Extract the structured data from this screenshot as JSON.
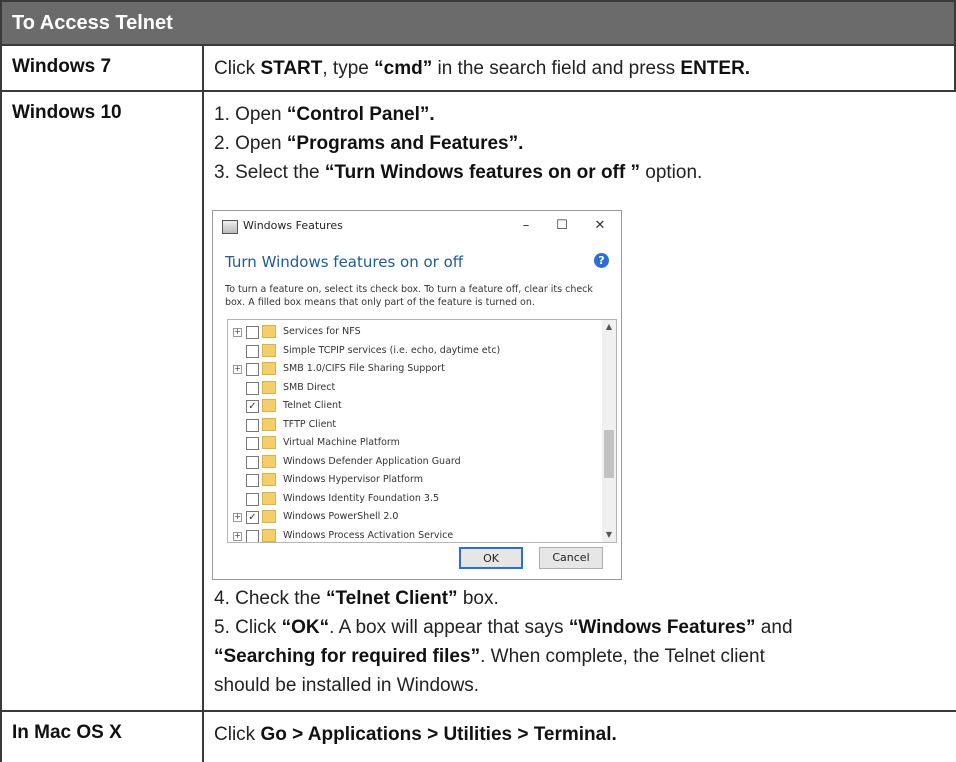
{
  "header": "To Access Telnet",
  "rows": {
    "win7": {
      "label": "Windows 7",
      "t1": "Click ",
      "b1": "START",
      "t2": ", type ",
      "b2": "“cmd”",
      "t3": " in the search field and press ",
      "b3": "ENTER."
    },
    "win10": {
      "label": "Windows 10",
      "step1_pre": "1. Open ",
      "step1_b": "“Control Panel”.",
      "step2_pre": "2. Open ",
      "step2_b": "“Programs and Features”.",
      "step3_pre": "3. Select the ",
      "step3_b": "“Turn Windows features on or off ”",
      "step3_post": " option.",
      "step4_pre": "4. Check the ",
      "step4_b": "“Telnet Client”",
      "step4_post": " box.",
      "step5_pre": "5. Click ",
      "step5_b1": "“OK“",
      "step5_mid": ". A box will appear that says ",
      "step5_b2": "“Windows Features”",
      "step5_and": " and",
      "step5_b3": "“Searching for required files”",
      "step5_post1": ". When complete, the Telnet client",
      "step5_post2": "should be installed in Windows."
    },
    "mac": {
      "label": "In Mac OS X",
      "pre": "Click ",
      "b": "Go > Applications > Utilities > Terminal."
    }
  },
  "dialog": {
    "title": "Windows Features",
    "minimize": "–",
    "maximize": "☐",
    "close": "✕",
    "heading": "Turn Windows features on or off",
    "help": "?",
    "description": "To turn a feature on, select its check box. To turn a feature off, clear its check box. A filled box means that only part of the feature is turned on.",
    "items": [
      {
        "label": "Services for NFS",
        "expand": true,
        "checked": false
      },
      {
        "label": "Simple TCPIP services (i.e. echo, daytime etc)",
        "expand": false,
        "checked": false
      },
      {
        "label": "SMB 1.0/CIFS File Sharing Support",
        "expand": true,
        "checked": false
      },
      {
        "label": "SMB Direct",
        "expand": false,
        "checked": false
      },
      {
        "label": "Telnet Client",
        "expand": false,
        "checked": true
      },
      {
        "label": "TFTP Client",
        "expand": false,
        "checked": false
      },
      {
        "label": "Virtual Machine Platform",
        "expand": false,
        "checked": false
      },
      {
        "label": "Windows Defender Application Guard",
        "expand": false,
        "checked": false
      },
      {
        "label": "Windows Hypervisor Platform",
        "expand": false,
        "checked": false
      },
      {
        "label": "Windows Identity Foundation 3.5",
        "expand": false,
        "checked": false
      },
      {
        "label": "Windows PowerShell 2.0",
        "expand": true,
        "checked": true
      },
      {
        "label": "Windows Process Activation Service",
        "expand": true,
        "checked": false
      }
    ],
    "ok": "OK",
    "cancel": "Cancel"
  }
}
